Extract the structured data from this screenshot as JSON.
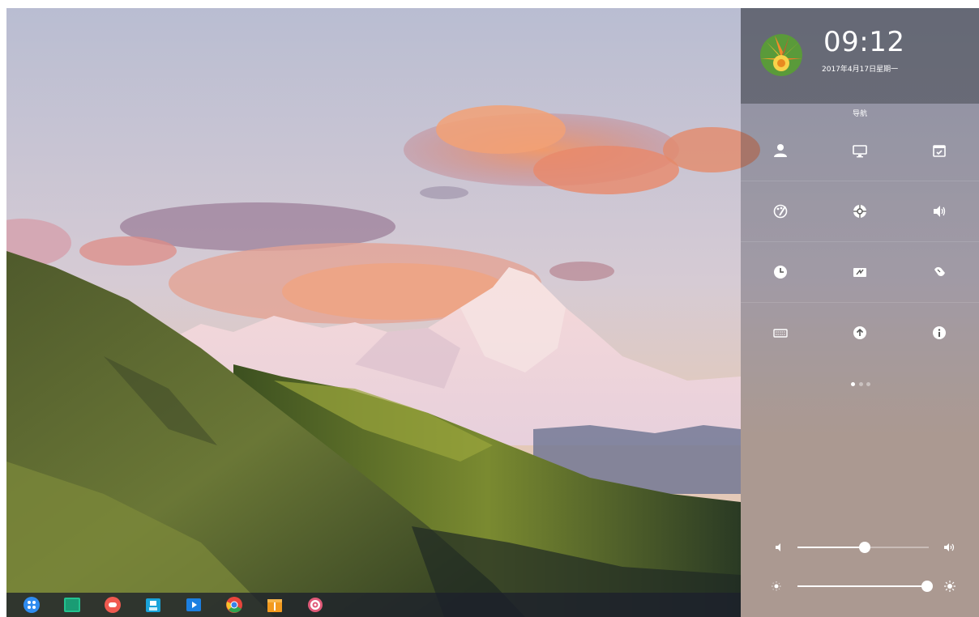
{
  "desktop": {
    "wallpaper_icon": "mountain-landscape"
  },
  "dock": {
    "items": [
      {
        "name": "launcher",
        "icon": "launcher-icon",
        "color": "#2f8cf0"
      },
      {
        "name": "terminal",
        "icon": "terminal-icon",
        "color": "#23c28f"
      },
      {
        "name": "screen-recorder",
        "icon": "record-icon",
        "color": "#f05a50"
      },
      {
        "name": "app-store",
        "icon": "store-icon",
        "color": "#1aa3d9"
      },
      {
        "name": "movie-player",
        "icon": "video-icon",
        "color": "#1c7fe0"
      },
      {
        "name": "chrome",
        "icon": "chrome-icon",
        "color": "#e8453c"
      },
      {
        "name": "archive-manager",
        "icon": "archive-icon",
        "color": "#f39a1e"
      },
      {
        "name": "system-settings",
        "icon": "gear-icon",
        "color": "#e05a78"
      }
    ]
  },
  "control_center": {
    "time": "09:12",
    "date": "2017年4月17日星期一",
    "section_title": "导航",
    "tiles": [
      {
        "name": "accounts",
        "icon": "user-icon"
      },
      {
        "name": "display",
        "icon": "monitor-icon"
      },
      {
        "name": "default-apps",
        "icon": "calendar-check-icon"
      },
      {
        "name": "personalization",
        "icon": "palette-icon"
      },
      {
        "name": "network",
        "icon": "network-icon"
      },
      {
        "name": "sound",
        "icon": "speaker-icon"
      },
      {
        "name": "time-date",
        "icon": "clock-icon"
      },
      {
        "name": "power",
        "icon": "battery-icon"
      },
      {
        "name": "mouse",
        "icon": "mouse-icon"
      },
      {
        "name": "keyboard",
        "icon": "keyboard-icon"
      },
      {
        "name": "update",
        "icon": "upload-icon"
      },
      {
        "name": "system-info",
        "icon": "info-icon"
      }
    ],
    "pager": {
      "pages": 3,
      "current": 1
    },
    "volume": {
      "level": 0.51
    },
    "brightness": {
      "level": 0.99
    }
  }
}
